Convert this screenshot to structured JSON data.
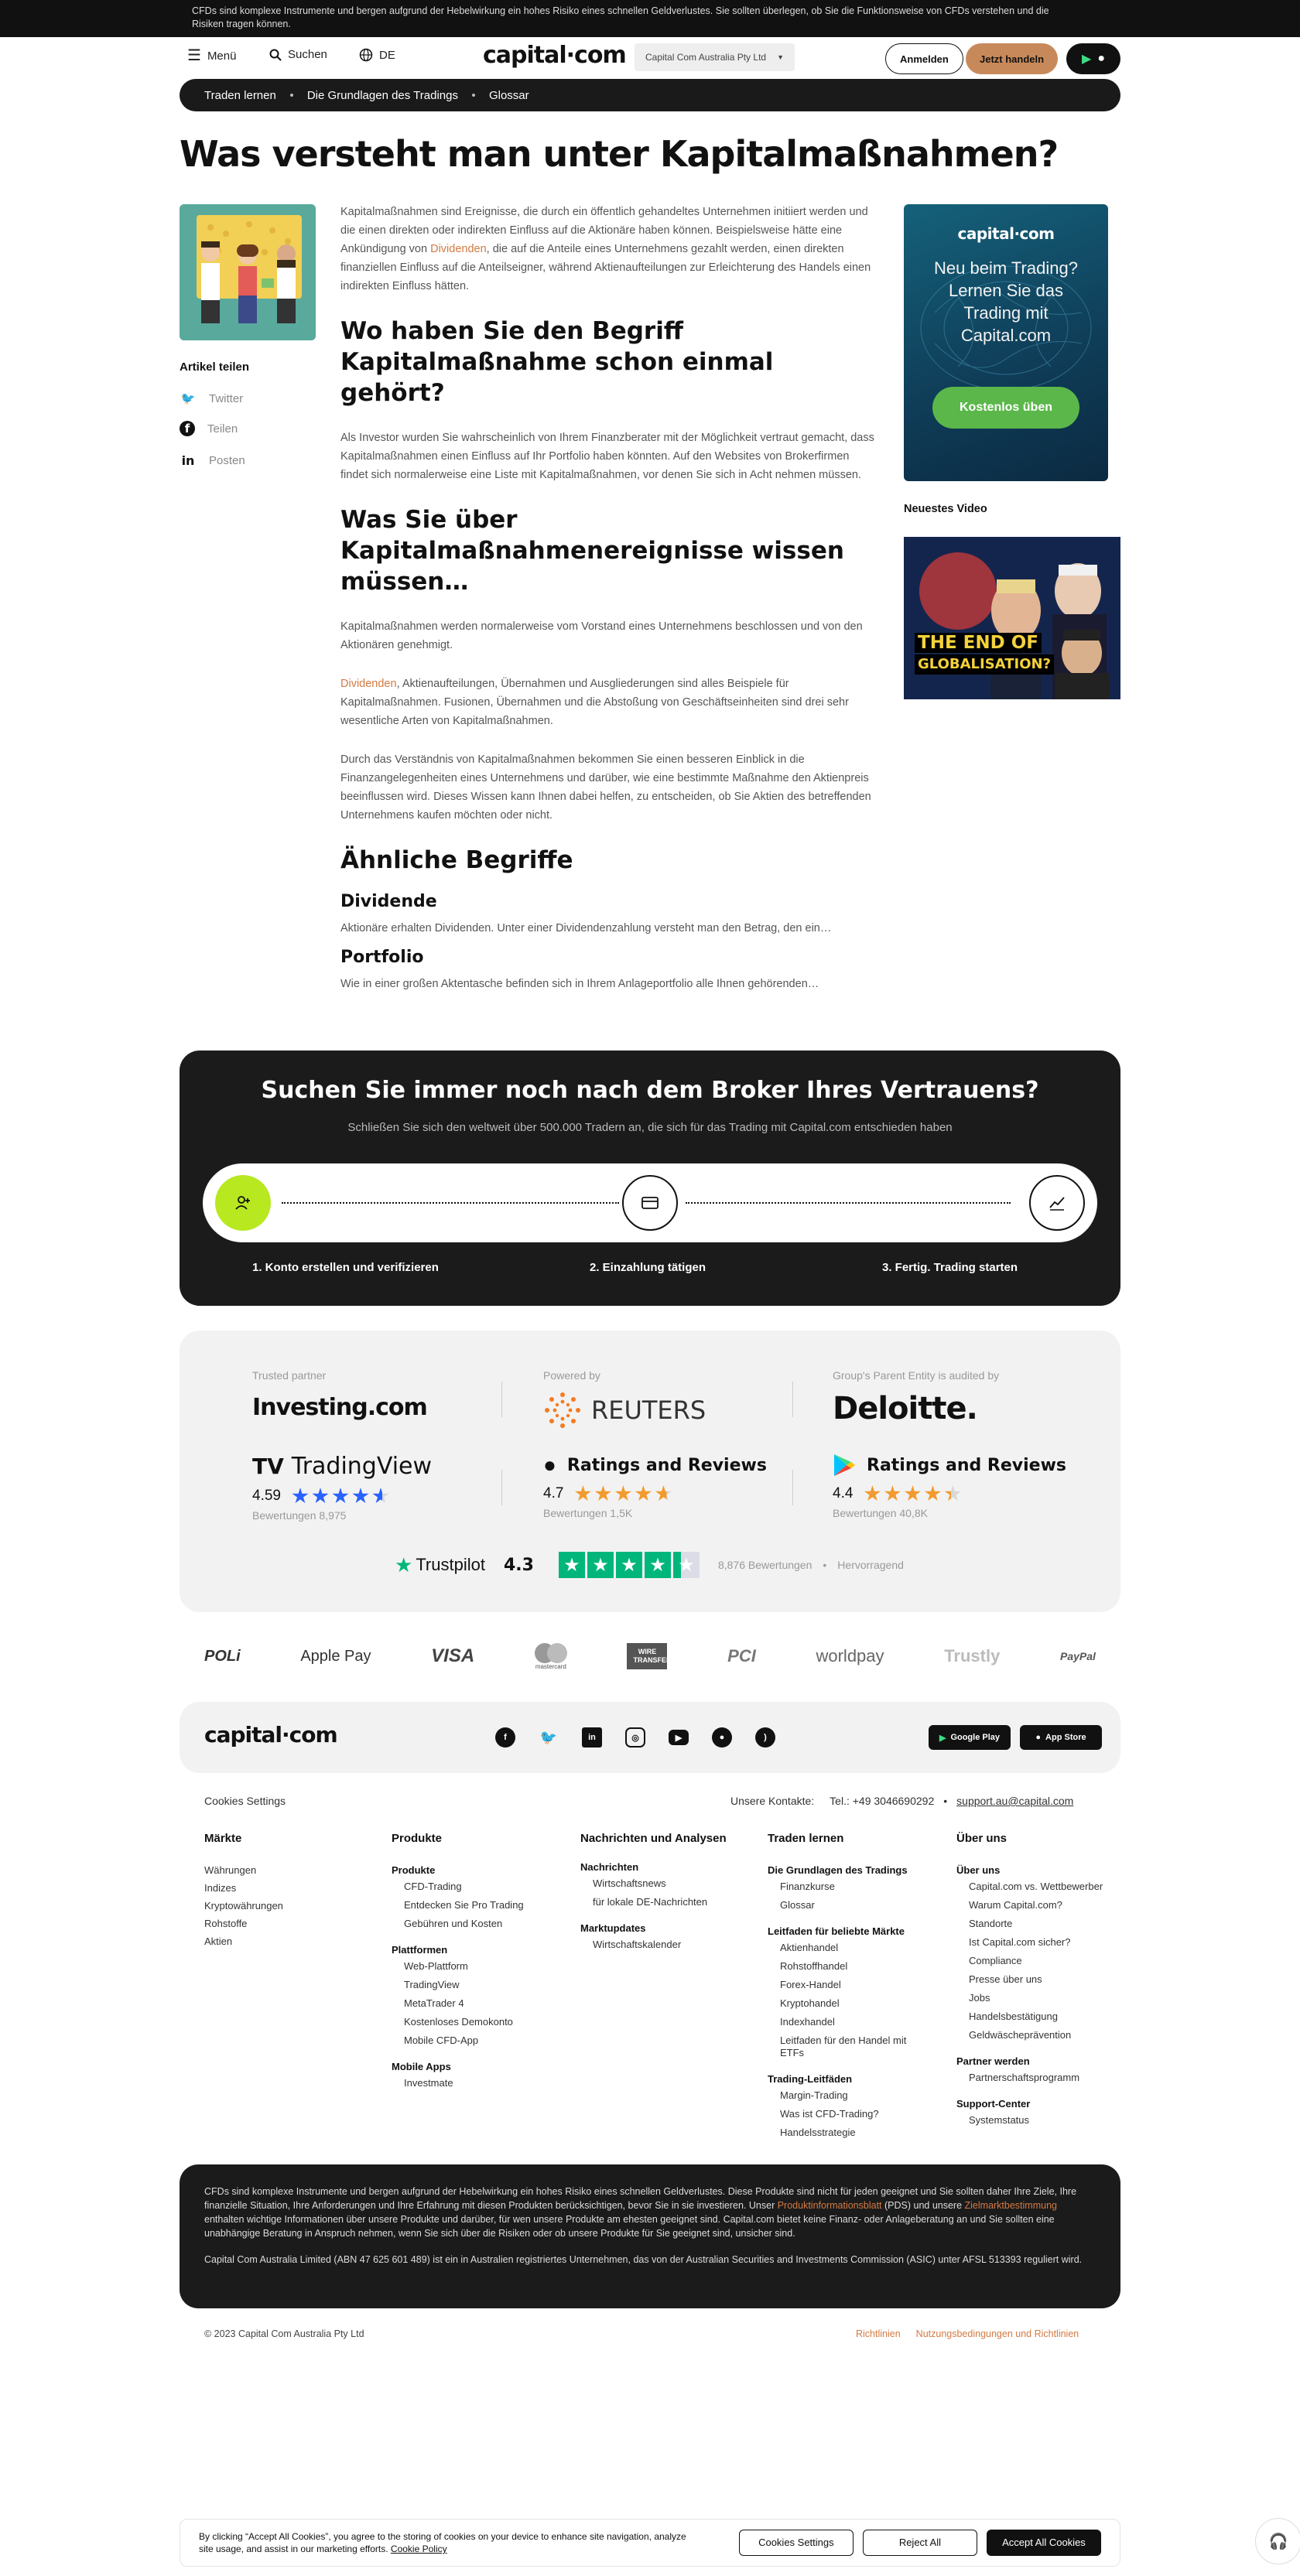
{
  "risk_banner": "CFDs sind komplexe Instrumente und bergen aufgrund der Hebelwirkung ein hohes Risiko eines schnellen Geldverlustes. Sie sollten überlegen, ob Sie die Funktionsweise von CFDs verstehen und die Risiken tragen können.",
  "header": {
    "menu": "Menü",
    "search": "Suchen",
    "lang": "DE",
    "logo": "capital·com",
    "entity": "Capital Com Australia Pty Ltd",
    "login": "Anmelden",
    "trade": "Jetzt handeln"
  },
  "breadcrumb": [
    "Traden lernen",
    "Die Grundlagen des Tradings",
    "Glossar"
  ],
  "title": "Was versteht man unter Kapitalmaßnahmen?",
  "share": {
    "title": "Artikel teilen",
    "items": [
      "Twitter",
      "Teilen",
      "Posten"
    ]
  },
  "article": {
    "p1a": "Kapitalmaßnahmen sind Ereignisse, die durch ein öffentlich gehandeltes Unternehmen initiiert werden und die einen direkten oder indirekten Einfluss auf die Aktionäre haben können. Beispielsweise hätte eine Ankündigung von ",
    "p1link": "Dividenden",
    "p1b": ", die auf die Anteile eines Unternehmens gezahlt werden, einen direkten finanziellen Einfluss auf die Anteilseigner, während Aktienaufteilungen zur Erleichterung des Handels einen indirekten Einfluss hätten.",
    "h2a": "Wo haben Sie den Begriff Kapitalmaßnahme schon einmal gehört?",
    "p2": "Als Investor wurden Sie wahrscheinlich von Ihrem Finanzberater mit der Möglichkeit vertraut gemacht, dass Kapitalmaßnahmen einen Einfluss auf Ihr Portfolio haben könnten. Auf den Websites von Brokerfirmen findet sich normalerweise eine Liste mit Kapitalmaßnahmen, vor denen Sie sich in Acht nehmen müssen.",
    "h2b": "Was Sie über Kapitalmaßnahmenereignisse wissen müssen…",
    "p3": "Kapitalmaßnahmen werden normalerweise vom Vorstand eines Unternehmens beschlossen und von den Aktionären genehmigt.",
    "p4link": "Dividenden",
    "p4": ", Aktienaufteilungen, Übernahmen und Ausgliederungen sind alles Beispiele für Kapitalmaßnahmen. Fusionen, Übernahmen und die Abstoßung von Geschäftseinheiten sind drei sehr wesentliche Arten von Kapitalmaßnahmen.",
    "p5": "Durch das Verständnis von Kapitalmaßnahmen bekommen Sie einen besseren Einblick in die Finanzangelegenheiten eines Unternehmens und darüber, wie eine bestimmte Maßnahme den Aktienpreis beeinflussen wird. Dieses Wissen kann Ihnen dabei helfen, zu entscheiden, ob Sie Aktien des betreffenden Unternehmens kaufen möchten oder nicht.",
    "related": "Ähnliche Begriffe",
    "r1": "Dividende",
    "r1text": "Aktionäre erhalten Dividenden. Unter einer Dividendenzahlung versteht man den Betrag, den ein…",
    "r2": "Portfolio",
    "r2text": "Wie in einer großen Aktentasche befinden sich in Ihrem Anlageportfolio alle Ihnen gehörenden…"
  },
  "promo": {
    "logo": "capital·com",
    "text": "Neu beim Trading? Lernen Sie das Trading mit Capital.com",
    "button": "Kostenlos üben"
  },
  "video": {
    "title": "Neuestes Video",
    "caption_line1": "THE END OF",
    "caption_line2": "GLOBALISATION?"
  },
  "broker": {
    "title": "Suchen Sie immer noch nach dem Broker Ihres Vertrauens?",
    "subtitle": "Schließen Sie sich den weltweit über 500.000 Tradern an, die sich für das Trading mit Capital.com entschieden haben",
    "steps": [
      "1. Konto erstellen und verifizieren",
      "2. Einzahlung tätigen",
      "3. Fertig. Trading starten"
    ]
  },
  "partners": {
    "trusted_label": "Trusted partner",
    "investing": "Investing.com",
    "powered_label": "Powered by",
    "reuters": "REUTERS",
    "audit_label": "Group's Parent Entity is audited by",
    "deloitte": "Deloitte.",
    "tv_name": "TradingView",
    "tv_rating": "4.59",
    "tv_reviews": "Bewertungen 8,975",
    "apple_name": "Ratings and Reviews",
    "apple_rating": "4.7",
    "apple_reviews": "Bewertungen 1,5K",
    "gplay_name": "Ratings and Reviews",
    "gplay_rating": "4.4",
    "gplay_reviews": "Bewertungen 40,8K",
    "tp_name": "Trustpilot",
    "tp_rating": "4.3",
    "tp_reviews": "8,876 Bewertungen",
    "tp_label": "Hervorragend",
    "colors": {
      "blue_star": "#2962ff",
      "orange_star": "#f29a2e",
      "tp_green": "#00b67a"
    }
  },
  "payments": [
    "POLi",
    "Apple Pay",
    "VISA",
    "mastercard",
    "WIRE TRANSFER",
    "PCI",
    "worldpay",
    "Trustly",
    "PayPal"
  ],
  "footer": {
    "logo": "capital·com",
    "social": [
      "facebook-icon",
      "twitter-icon",
      "linkedin-icon",
      "instagram-icon",
      "youtube-icon",
      "reddit-icon",
      "rss-icon"
    ],
    "gplay": "Google Play",
    "appstore": "App Store",
    "cookies": "Cookies Settings",
    "contacts_label": "Unsere Kontakte:",
    "phone": "Tel.: +49 3046690292",
    "email": "support.au@capital.com",
    "col1": {
      "title": "Märkte",
      "items": [
        "Währungen",
        "Indizes",
        "Kryptowährungen",
        "Rohstoffe",
        "Aktien"
      ]
    },
    "col2": {
      "title": "Produkte",
      "g1": "Produkte",
      "g1items": [
        "CFD-Trading",
        "Entdecken Sie Pro Trading",
        "Gebühren und Kosten"
      ],
      "g2": "Plattformen",
      "g2items": [
        "Web-Plattform",
        "TradingView",
        "MetaTrader 4",
        "Kostenloses Demokonto",
        "Mobile CFD-App"
      ],
      "g3": "Mobile Apps",
      "g3items": [
        "Investmate"
      ]
    },
    "col3": {
      "title": "Nachrichten und Analysen",
      "g1": "Nachrichten",
      "g1items": [
        "Wirtschaftsnews",
        "für lokale DE-Nachrichten"
      ],
      "g2": "Marktupdates",
      "g2items": [
        "Wirtschaftskalender"
      ]
    },
    "col4": {
      "title": "Traden lernen",
      "g1": "Die Grundlagen des Tradings",
      "g1items": [
        "Finanzkurse",
        "Glossar"
      ],
      "g2": "Leitfaden für beliebte Märkte",
      "g2items": [
        "Aktienhandel",
        "Rohstoffhandel",
        "Forex-Handel",
        "Kryptohandel",
        "Indexhandel",
        "Leitfaden für den Handel mit ETFs"
      ],
      "g3": "Trading-Leitfäden",
      "g3items": [
        "Margin-Trading",
        "Was ist CFD-Trading?",
        "Handelsstrategie"
      ]
    },
    "col5": {
      "title": "Über uns",
      "g1": "Über uns",
      "g1items": [
        "Capital.com vs. Wettbewerber",
        "Warum Capital.com?",
        "Standorte",
        "Ist Capital.com sicher?",
        "Compliance",
        "Presse über uns",
        "Jobs",
        "Handelsbestätigung",
        "Geldwäscheprävention"
      ],
      "g2": "Partner werden",
      "g2items": [
        "Partnerschaftsprogramm"
      ],
      "g3": "Support-Center",
      "g3items": [
        "Systemstatus"
      ]
    }
  },
  "legal": {
    "p1a": "CFDs sind komplexe Instrumente und bergen aufgrund der Hebelwirkung ein hohes Risiko eines schnellen Geldverlustes. Diese Produkte sind nicht für jeden geeignet und Sie sollten daher Ihre Ziele, Ihre finanzielle Situation, Ihre Anforderungen und Ihre Erfahrung mit diesen Produkten berücksichtigen, bevor Sie in sie investieren. Unser ",
    "link1": "Produktinformationsblatt",
    "p1b": " (PDS) und unsere ",
    "link2": "Zielmarktbestimmung",
    "p1c": " enthalten wichtige Informationen über unsere Produkte und darüber, für wen unsere Produkte am ehesten geeignet sind. Capital.com bietet keine Finanz- oder Anlageberatung an und Sie sollten eine unabhängige Beratung in Anspruch nehmen, wenn Sie sich über die Risiken oder ob unsere Produkte für Sie geeignet sind, unsicher sind.",
    "p2": "Capital Com Australia Limited (ABN 47 625 601 489) ist ein in Australien registriertes Unternehmen, das von der Australian Securities and Investments Commission (ASIC) unter AFSL 513393 reguliert wird."
  },
  "copyright": "© 2023 Capital Com Australia Pty Ltd",
  "bottom_links": [
    "Richtlinien",
    "Nutzungsbedingungen und Richtlinien"
  ],
  "cookie": {
    "text_a": "By clicking “Accept All Cookies”, you agree to the storing of cookies on your device to enhance site navigation, analyze site usage, and assist in our marketing efforts. ",
    "link": "Cookie Policy",
    "settings": "Cookies Settings",
    "reject": "Reject All",
    "accept": "Accept All Cookies"
  }
}
